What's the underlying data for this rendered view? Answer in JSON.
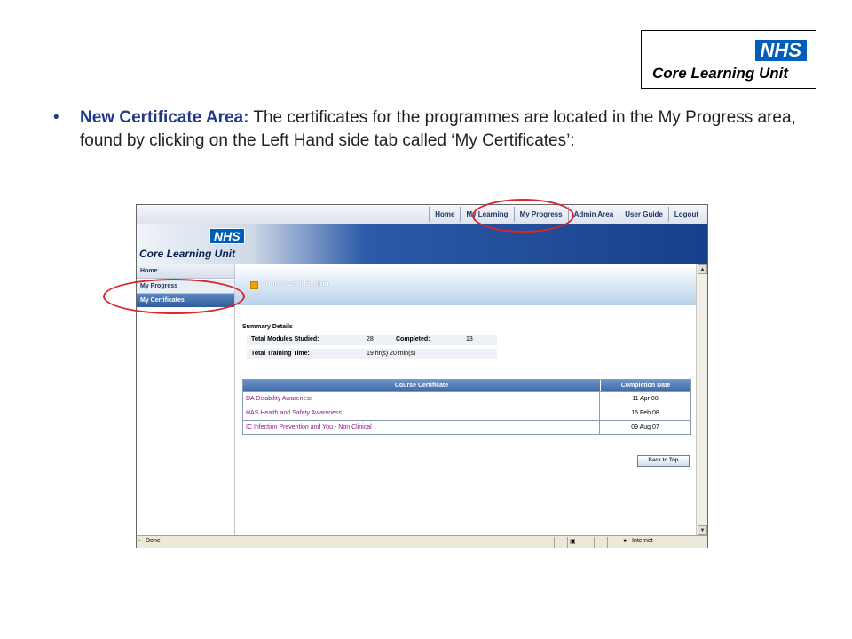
{
  "logo": {
    "nhs": "NHS",
    "unit": "Core Learning Unit"
  },
  "bullet": {
    "lead": "New Certificate Area:",
    "body": " The certificates for the programmes are located in the My Progress area, found by clicking on the Left Hand side tab called ‘My Certificates’:"
  },
  "screenshot": {
    "topnav": [
      "Home",
      "My Learning",
      "My Progress",
      "Admin Area",
      "User Guide",
      "Logout"
    ],
    "banner": {
      "nhs": "NHS",
      "unit": "Core Learning Unit"
    },
    "sidebar": {
      "home": "Home",
      "my_progress": "My Progress",
      "my_certificates": "My Certificates"
    },
    "page_title": "Course Certification",
    "summary": {
      "heading": "Summary Details",
      "modules_label": "Total Modules Studied:",
      "modules_value": "28",
      "completed_label": "Completed:",
      "completed_value": "13",
      "time_label": "Total Training Time:",
      "time_value": "19 hr(s) 20 min(s)"
    },
    "table": {
      "col_course": "Course Certificate",
      "col_date": "Completion Date",
      "rows": [
        {
          "course": "DA Disability Awareness",
          "date": "11 Apr 08"
        },
        {
          "course": "HAS Health and Safety Awareness",
          "date": "15 Feb 08"
        },
        {
          "course": "IC Infection Prevention and You - Non Clinical",
          "date": "09 Aug 07"
        }
      ]
    },
    "back_to_top": "Back to Top",
    "status": {
      "done": "Done",
      "zone": "Internet"
    }
  },
  "colors": {
    "annotation": "#d8242a",
    "nhs_blue": "#005eb8",
    "heading_blue": "#1f3a8a"
  }
}
